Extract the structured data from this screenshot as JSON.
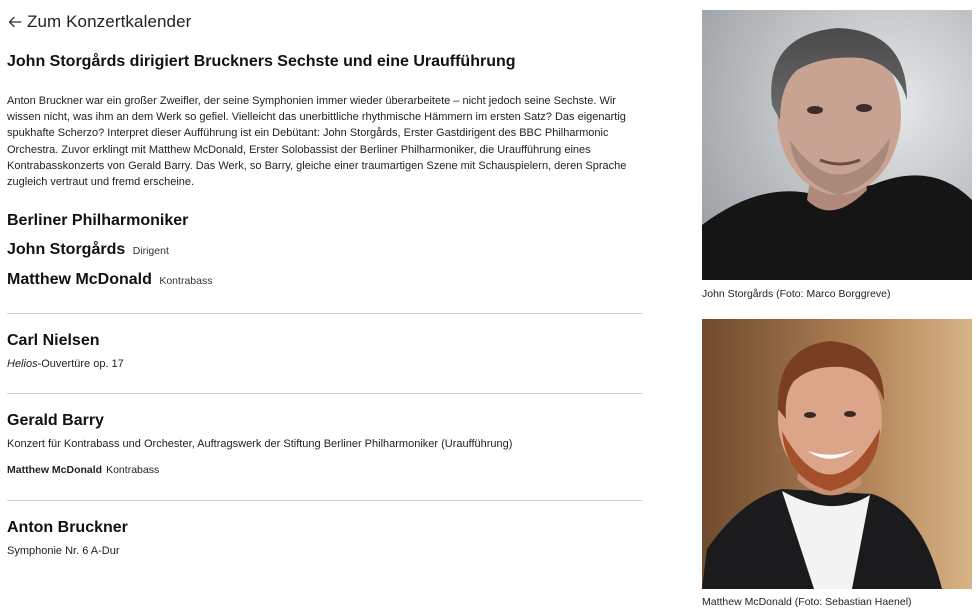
{
  "nav": {
    "back_label": "Zum Konzertkalender"
  },
  "page": {
    "title": "John Storgårds dirigiert Bruckners Sechste und eine Uraufführung",
    "intro": "Anton Bruckner war ein großer Zweifler, der seine Symphonien immer wieder überarbeitete – nicht jedoch seine Sechste. Wir wissen nicht, was ihm an dem Werk so gefiel. Vielleicht das unerbittliche rhythmische Hämmern im ersten Satz? Das eigenartig spukhafte Scherzo? Interpret dieser Aufführung ist ein Debütant: John Storgårds, Erster Gastdirigent des BBC Philharmonic Orchestra. Zuvor erklingt mit Matthew McDonald, Erster Solobassist der Berliner Philharmoniker, die Uraufführung eines Kontrabasskonzerts von Gerald Barry. Das Werk, so Barry, gleiche einer traumartigen Szene mit Schauspielern, deren Sprache zugleich vertraut und fremd erscheine."
  },
  "performers": {
    "ensemble": "Berliner Philharmoniker",
    "artists": [
      {
        "name": "John Storgårds",
        "role": "Dirigent"
      },
      {
        "name": "Matthew McDonald",
        "role": "Kontrabass"
      }
    ]
  },
  "program": [
    {
      "composer": "Carl Nielsen",
      "work_italic": "Helios",
      "work_rest": "-Ouvertüre op. 17"
    },
    {
      "composer": "Gerald Barry",
      "work": "Konzert für Kontrabass und Orchester, Auftragswerk der Stiftung Berliner Philharmoniker (Uraufführung)",
      "performer_name": "Matthew McDonald",
      "performer_role": "Kontrabass"
    },
    {
      "composer": "Anton Bruckner",
      "work": "Symphonie Nr. 6 A-Dur"
    }
  ],
  "photos": [
    {
      "caption": "John Storgårds (Foto: Marco Borggreve)"
    },
    {
      "caption": "Matthew McDonald (Foto: Sebastian Haenel)"
    }
  ],
  "colors": {
    "text": "#1a1a1a",
    "divider": "#cfcfcf"
  }
}
